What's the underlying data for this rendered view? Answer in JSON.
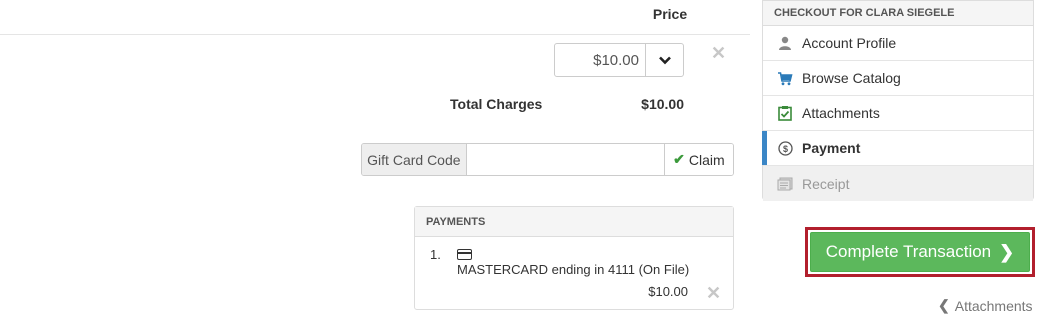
{
  "cart": {
    "price_header": "Price",
    "price_value": "$10.00",
    "total_label": "Total Charges",
    "total_value": "$10.00"
  },
  "gift_card": {
    "addon_label": "Gift Card Code",
    "input_value": "",
    "claim_label": "Claim"
  },
  "payments": {
    "header": "PAYMENTS",
    "items": [
      {
        "number": "1.",
        "description": "MASTERCARD ending in 4111 (On File)",
        "amount": "$10.00"
      }
    ]
  },
  "checkout_nav": {
    "title": "Checkout for Clara Siegele",
    "items": [
      {
        "label": "Account Profile",
        "icon": "user-icon",
        "state": "normal"
      },
      {
        "label": "Browse Catalog",
        "icon": "cart-icon",
        "state": "normal"
      },
      {
        "label": "Attachments",
        "icon": "clipboard-icon",
        "state": "normal"
      },
      {
        "label": "Payment",
        "icon": "dollar-circle-icon",
        "state": "active"
      },
      {
        "label": "Receipt",
        "icon": "receipt-icon",
        "state": "disabled"
      }
    ]
  },
  "actions": {
    "complete_label": "Complete Transaction",
    "back_label": "Attachments"
  },
  "colors": {
    "accent_active": "#3b86c6",
    "success": "#5cb85c",
    "highlight_border": "#b21f2d"
  }
}
